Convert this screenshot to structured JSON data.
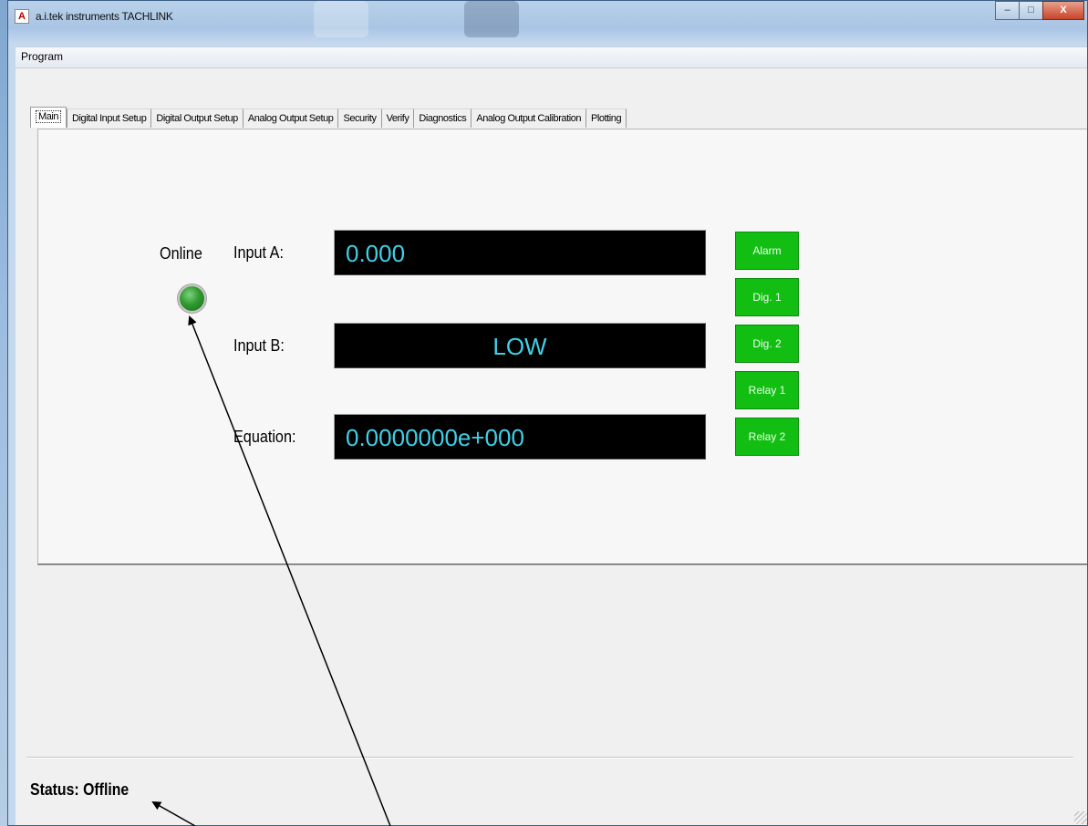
{
  "window": {
    "title": "a.i.tek instruments TACHLINK",
    "controls": {
      "minimize": "–",
      "maximize": "□",
      "close": "X"
    }
  },
  "menu": {
    "items": [
      "Program"
    ]
  },
  "tabs": [
    "Main",
    "Digital Input Setup",
    "Digital Output Setup",
    "Analog Output Setup",
    "Security",
    "Verify",
    "Diagnostics",
    "Analog Output Calibration",
    "Plotting"
  ],
  "active_tab": "Main",
  "main": {
    "online_label": "Online",
    "input_a_label": "Input A:",
    "input_a_value": "0.000",
    "input_b_label": "Input B:",
    "input_b_value": "LOW",
    "equation_label": "Equation:",
    "equation_value": "0.0000000e+000",
    "status_buttons": [
      "Alarm",
      "Dig. 1",
      "Dig. 2",
      "Relay 1",
      "Relay 2"
    ]
  },
  "status": {
    "text": "Status: Offline"
  },
  "colors": {
    "display_text": "#3fd0e8",
    "display_bg": "#000000",
    "indicator_green": "#13be13",
    "led_green": "#2f9a2f"
  }
}
